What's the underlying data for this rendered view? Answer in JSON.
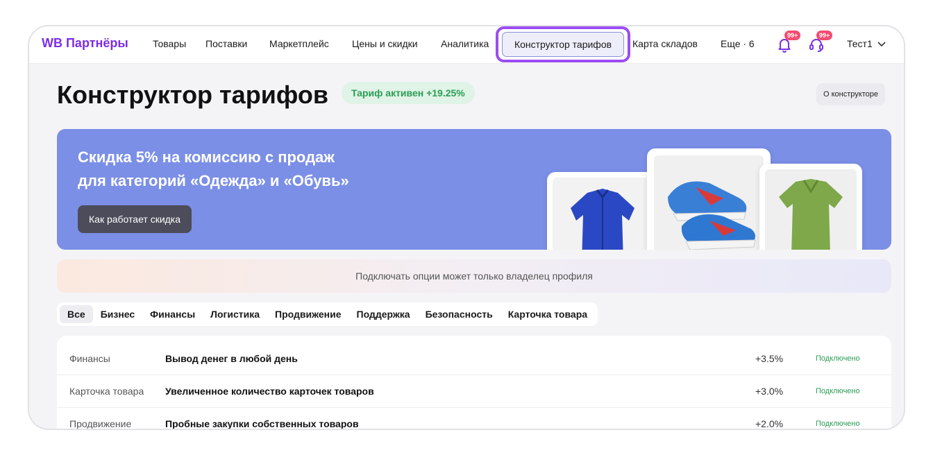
{
  "nav": {
    "logo": "WB Партнёры",
    "items": [
      "Товары",
      "Поставки",
      "Маркетплейс",
      "Цены и скидки",
      "Аналитика"
    ],
    "active": "Конструктор тарифов",
    "items_after": [
      "Карта складов",
      "Еще · 6"
    ],
    "notifications_badge": "99+",
    "support_badge": "99+",
    "user": "Тест1"
  },
  "header": {
    "title": "Конструктор тарифов",
    "status": "Тариф активен +19.25%",
    "about_button": "О конструкторе"
  },
  "banner": {
    "title_line1": "Скидка 5% на комиссию с продаж",
    "title_line2": "для категорий «Одежда» и «Обувь»",
    "button": "Как работает скидка"
  },
  "notice": "Подключать опции может только владелец профиля",
  "tabs": [
    "Все",
    "Бизнес",
    "Финансы",
    "Логистика",
    "Продвижение",
    "Поддержка",
    "Безопасность",
    "Карточка товара"
  ],
  "table": {
    "rows": [
      {
        "category": "Финансы",
        "name": "Вывод денег в любой день",
        "percent": "+3.5%",
        "status": "Подключено"
      },
      {
        "category": "Карточка товара",
        "name": "Увеличенное количество карточек товаров",
        "percent": "+3.0%",
        "status": "Подключено"
      },
      {
        "category": "Продвижение",
        "name": "Пробные закупки собственных товаров",
        "percent": "+2.0%",
        "status": "Подключено"
      }
    ]
  },
  "colors": {
    "brand": "#7b2ee6",
    "banner": "#7b8fe6",
    "success": "#2a9d55",
    "badge": "#f44c70",
    "highlight": "#9b4df2"
  }
}
